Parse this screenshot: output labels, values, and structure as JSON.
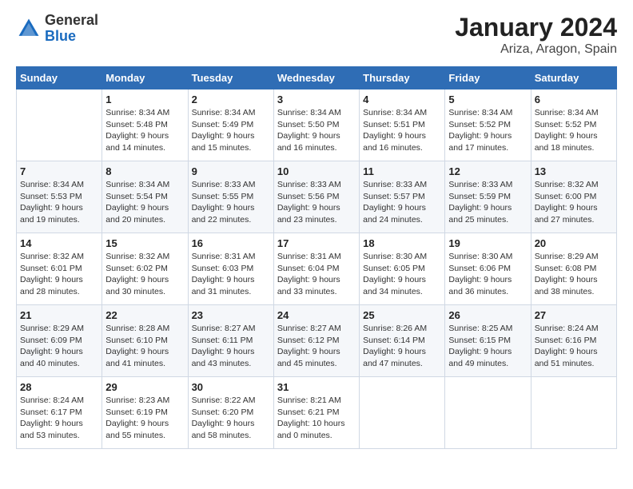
{
  "header": {
    "logo_general": "General",
    "logo_blue": "Blue",
    "title": "January 2024",
    "subtitle": "Ariza, Aragon, Spain"
  },
  "days_of_week": [
    "Sunday",
    "Monday",
    "Tuesday",
    "Wednesday",
    "Thursday",
    "Friday",
    "Saturday"
  ],
  "weeks": [
    [
      {
        "day": "",
        "sunrise": "",
        "sunset": "",
        "daylight": ""
      },
      {
        "day": "1",
        "sunrise": "Sunrise: 8:34 AM",
        "sunset": "Sunset: 5:48 PM",
        "daylight": "Daylight: 9 hours and 14 minutes."
      },
      {
        "day": "2",
        "sunrise": "Sunrise: 8:34 AM",
        "sunset": "Sunset: 5:49 PM",
        "daylight": "Daylight: 9 hours and 15 minutes."
      },
      {
        "day": "3",
        "sunrise": "Sunrise: 8:34 AM",
        "sunset": "Sunset: 5:50 PM",
        "daylight": "Daylight: 9 hours and 16 minutes."
      },
      {
        "day": "4",
        "sunrise": "Sunrise: 8:34 AM",
        "sunset": "Sunset: 5:51 PM",
        "daylight": "Daylight: 9 hours and 16 minutes."
      },
      {
        "day": "5",
        "sunrise": "Sunrise: 8:34 AM",
        "sunset": "Sunset: 5:52 PM",
        "daylight": "Daylight: 9 hours and 17 minutes."
      },
      {
        "day": "6",
        "sunrise": "Sunrise: 8:34 AM",
        "sunset": "Sunset: 5:52 PM",
        "daylight": "Daylight: 9 hours and 18 minutes."
      }
    ],
    [
      {
        "day": "7",
        "sunrise": "Sunrise: 8:34 AM",
        "sunset": "Sunset: 5:53 PM",
        "daylight": "Daylight: 9 hours and 19 minutes."
      },
      {
        "day": "8",
        "sunrise": "Sunrise: 8:34 AM",
        "sunset": "Sunset: 5:54 PM",
        "daylight": "Daylight: 9 hours and 20 minutes."
      },
      {
        "day": "9",
        "sunrise": "Sunrise: 8:33 AM",
        "sunset": "Sunset: 5:55 PM",
        "daylight": "Daylight: 9 hours and 22 minutes."
      },
      {
        "day": "10",
        "sunrise": "Sunrise: 8:33 AM",
        "sunset": "Sunset: 5:56 PM",
        "daylight": "Daylight: 9 hours and 23 minutes."
      },
      {
        "day": "11",
        "sunrise": "Sunrise: 8:33 AM",
        "sunset": "Sunset: 5:57 PM",
        "daylight": "Daylight: 9 hours and 24 minutes."
      },
      {
        "day": "12",
        "sunrise": "Sunrise: 8:33 AM",
        "sunset": "Sunset: 5:59 PM",
        "daylight": "Daylight: 9 hours and 25 minutes."
      },
      {
        "day": "13",
        "sunrise": "Sunrise: 8:32 AM",
        "sunset": "Sunset: 6:00 PM",
        "daylight": "Daylight: 9 hours and 27 minutes."
      }
    ],
    [
      {
        "day": "14",
        "sunrise": "Sunrise: 8:32 AM",
        "sunset": "Sunset: 6:01 PM",
        "daylight": "Daylight: 9 hours and 28 minutes."
      },
      {
        "day": "15",
        "sunrise": "Sunrise: 8:32 AM",
        "sunset": "Sunset: 6:02 PM",
        "daylight": "Daylight: 9 hours and 30 minutes."
      },
      {
        "day": "16",
        "sunrise": "Sunrise: 8:31 AM",
        "sunset": "Sunset: 6:03 PM",
        "daylight": "Daylight: 9 hours and 31 minutes."
      },
      {
        "day": "17",
        "sunrise": "Sunrise: 8:31 AM",
        "sunset": "Sunset: 6:04 PM",
        "daylight": "Daylight: 9 hours and 33 minutes."
      },
      {
        "day": "18",
        "sunrise": "Sunrise: 8:30 AM",
        "sunset": "Sunset: 6:05 PM",
        "daylight": "Daylight: 9 hours and 34 minutes."
      },
      {
        "day": "19",
        "sunrise": "Sunrise: 8:30 AM",
        "sunset": "Sunset: 6:06 PM",
        "daylight": "Daylight: 9 hours and 36 minutes."
      },
      {
        "day": "20",
        "sunrise": "Sunrise: 8:29 AM",
        "sunset": "Sunset: 6:08 PM",
        "daylight": "Daylight: 9 hours and 38 minutes."
      }
    ],
    [
      {
        "day": "21",
        "sunrise": "Sunrise: 8:29 AM",
        "sunset": "Sunset: 6:09 PM",
        "daylight": "Daylight: 9 hours and 40 minutes."
      },
      {
        "day": "22",
        "sunrise": "Sunrise: 8:28 AM",
        "sunset": "Sunset: 6:10 PM",
        "daylight": "Daylight: 9 hours and 41 minutes."
      },
      {
        "day": "23",
        "sunrise": "Sunrise: 8:27 AM",
        "sunset": "Sunset: 6:11 PM",
        "daylight": "Daylight: 9 hours and 43 minutes."
      },
      {
        "day": "24",
        "sunrise": "Sunrise: 8:27 AM",
        "sunset": "Sunset: 6:12 PM",
        "daylight": "Daylight: 9 hours and 45 minutes."
      },
      {
        "day": "25",
        "sunrise": "Sunrise: 8:26 AM",
        "sunset": "Sunset: 6:14 PM",
        "daylight": "Daylight: 9 hours and 47 minutes."
      },
      {
        "day": "26",
        "sunrise": "Sunrise: 8:25 AM",
        "sunset": "Sunset: 6:15 PM",
        "daylight": "Daylight: 9 hours and 49 minutes."
      },
      {
        "day": "27",
        "sunrise": "Sunrise: 8:24 AM",
        "sunset": "Sunset: 6:16 PM",
        "daylight": "Daylight: 9 hours and 51 minutes."
      }
    ],
    [
      {
        "day": "28",
        "sunrise": "Sunrise: 8:24 AM",
        "sunset": "Sunset: 6:17 PM",
        "daylight": "Daylight: 9 hours and 53 minutes."
      },
      {
        "day": "29",
        "sunrise": "Sunrise: 8:23 AM",
        "sunset": "Sunset: 6:19 PM",
        "daylight": "Daylight: 9 hours and 55 minutes."
      },
      {
        "day": "30",
        "sunrise": "Sunrise: 8:22 AM",
        "sunset": "Sunset: 6:20 PM",
        "daylight": "Daylight: 9 hours and 58 minutes."
      },
      {
        "day": "31",
        "sunrise": "Sunrise: 8:21 AM",
        "sunset": "Sunset: 6:21 PM",
        "daylight": "Daylight: 10 hours and 0 minutes."
      },
      {
        "day": "",
        "sunrise": "",
        "sunset": "",
        "daylight": ""
      },
      {
        "day": "",
        "sunrise": "",
        "sunset": "",
        "daylight": ""
      },
      {
        "day": "",
        "sunrise": "",
        "sunset": "",
        "daylight": ""
      }
    ]
  ]
}
